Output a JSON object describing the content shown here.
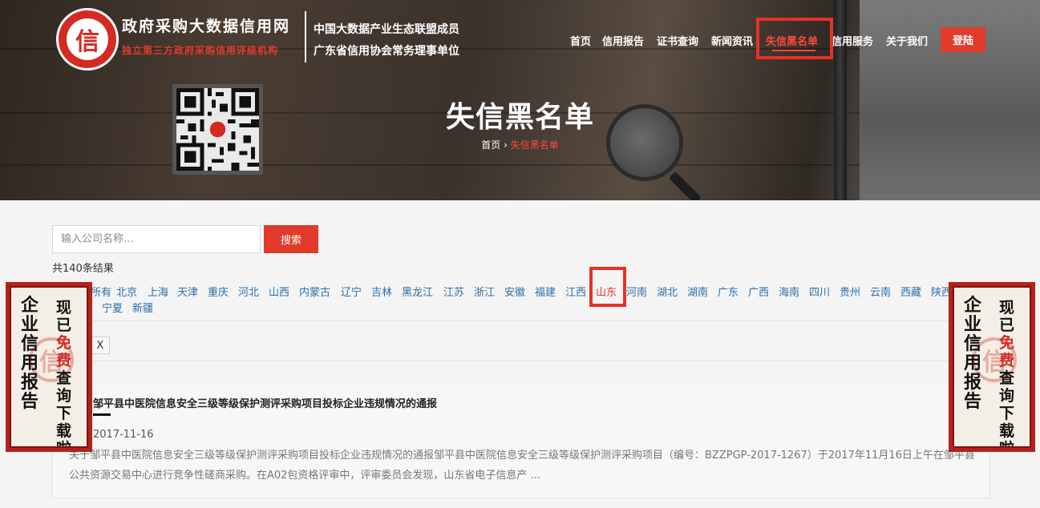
{
  "header": {
    "logo_glyph": "信",
    "site_name": "政府采购大数据信用网",
    "site_tagline": "独立第三方政府采购信用评级机构",
    "membership": [
      "中国大数据产业生态联盟成员",
      "广东省信用协会常务理事单位"
    ],
    "nav": [
      "首页",
      "信用报告",
      "证书查询",
      "新闻资讯",
      "失信黑名单",
      "信用服务",
      "关于我们"
    ],
    "active_nav": "失信黑名单",
    "login_label": "登陆"
  },
  "hero": {
    "title": "失信黑名单",
    "breadcrumb": [
      "首页",
      "失信黑名单"
    ],
    "breadcrumb_sep": "›"
  },
  "search": {
    "placeholder": "输入公司名称...",
    "button_label": "搜索",
    "result_count": "共140条结果"
  },
  "regions": {
    "row1": [
      "所有",
      "北京",
      "上海",
      "天津",
      "重庆",
      "河北",
      "山西",
      "内蒙古",
      "辽宁",
      "吉林",
      "黑龙江",
      "江苏",
      "浙江",
      "安徽",
      "福建",
      "江西",
      "山东",
      "河南",
      "湖北",
      "湖南",
      "广东",
      "广西",
      "海南",
      "四川",
      "贵州",
      "云南",
      "西藏",
      "陕西"
    ],
    "row2": [
      "宁夏",
      "新疆"
    ],
    "active": "山东"
  },
  "filter": {
    "clear_label": "X"
  },
  "articles": [
    {
      "title": "邹平县中医院信息安全三级等级保护测评采购项目投标企业违规情况的通报",
      "date": "2017-11-16",
      "summary": "关于邹平县中医院信息安全三级等级保护测评采购项目投标企业违规情况的通报邹平县中医院信息安全三级等级保护测评采购项目（编号：BZZPGP-2017-1267）于2017年11月16日上午在邹平县公共资源交易中心进行竞争性磋商采购。在A02包资格评审中，评审委员会发现，山东省电子信息产 ..."
    }
  ],
  "side_banner": {
    "line1": "企业信用报告",
    "line2_prefix": "现已",
    "line2_highlight": "免费",
    "line2_suffix": "查询下载啦",
    "seal_glyph": "信"
  },
  "colors": {
    "accent": "#e23b2b",
    "link": "#2b6fa8",
    "highlight_box": "#e53224"
  }
}
